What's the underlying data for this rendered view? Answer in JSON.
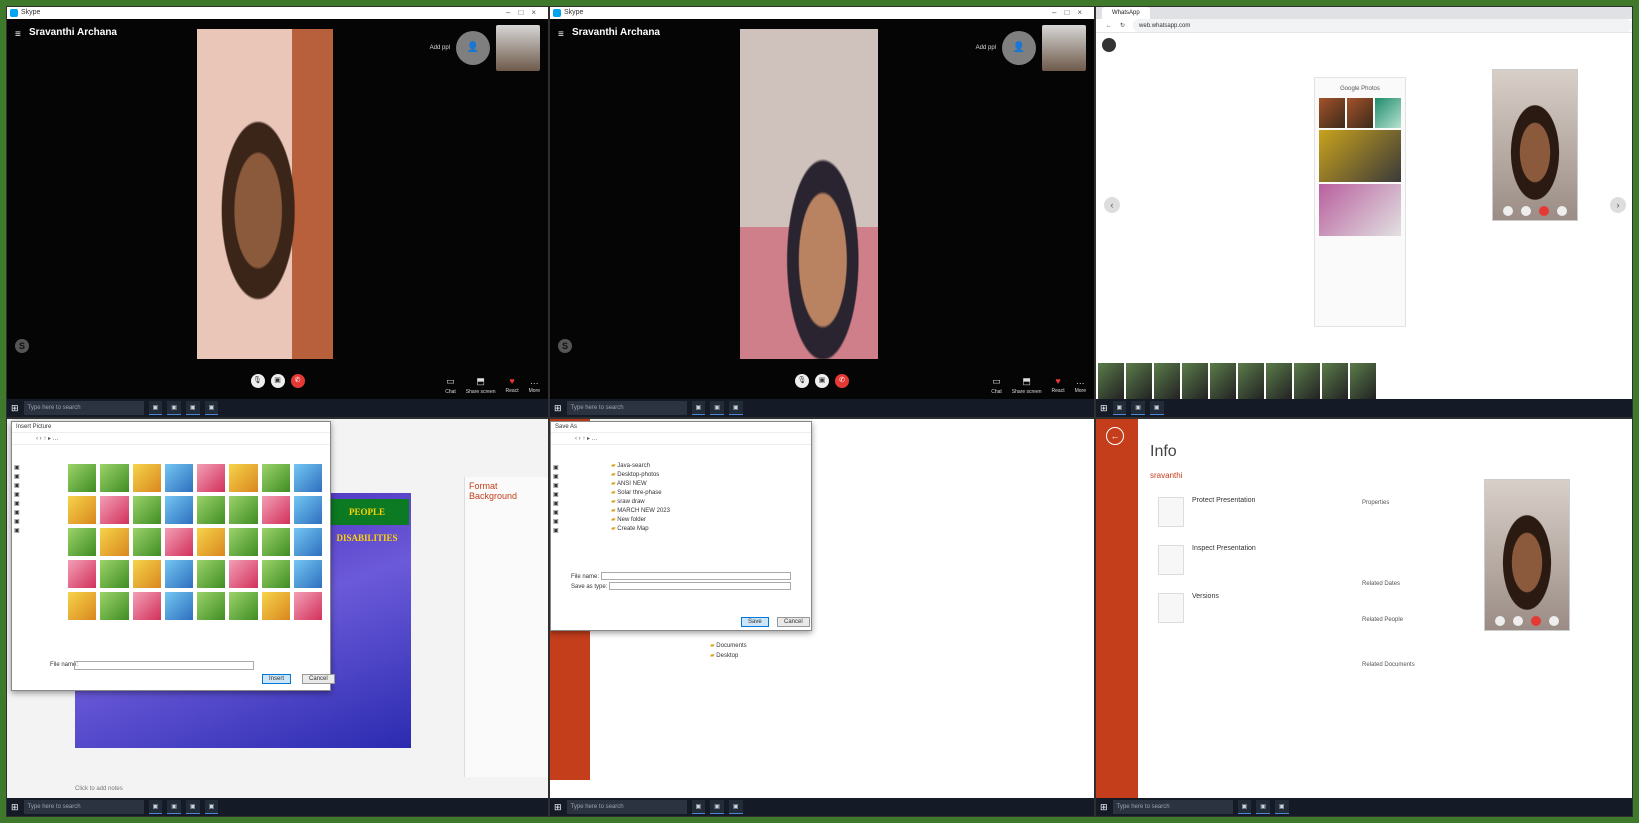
{
  "skype_window_title": "Skype",
  "skype_left": {
    "contact_name": "Sravanthi Archana",
    "add_people": "Add ppl"
  },
  "skype_mid": {
    "contact_name": "Sravanthi Archana",
    "add_people": "Add ppl"
  },
  "skype_tools": {
    "chat": "Chat",
    "share": "Share screen",
    "react": "React",
    "more": "More"
  },
  "chrome": {
    "tab": "WhatsApp",
    "url": "web.whatsapp.com",
    "phone_app_title": "Google Photos"
  },
  "ppt": {
    "insert_dialog_title": "Insert Picture",
    "slide_title": "PEOPLE DISABILITIES",
    "format_pane_title": "Format Background",
    "file_name_label": "File name:",
    "insert_button": "Insert",
    "cancel_button": "Cancel",
    "click_to_add_notes": "Click to add notes"
  },
  "save_dialog": {
    "title": "Save As",
    "file_name_label": "File name:",
    "save_type_label": "Save as type:",
    "save_button": "Save",
    "cancel_button": "Cancel",
    "folders": [
      "Java-search",
      "Desktop-photos",
      "ANSI NEW",
      "Solar thre-phase",
      "sraw draw",
      "MARCH NEW 2023",
      "New folder",
      "Create Map"
    ],
    "places": [
      "Documents",
      "Desktop"
    ]
  },
  "backstage": {
    "heading": "Info",
    "user": "sravanthi",
    "sections": [
      {
        "title": "Protect Presentation"
      },
      {
        "title": "Inspect Presentation"
      },
      {
        "title": "Versions"
      }
    ],
    "properties_title": "Properties",
    "related_dates": "Related Dates",
    "related_people": "Related People",
    "related_docs": "Related Documents"
  },
  "taskbar_search": "Type here to search",
  "colors": {
    "ppt_orange": "#c43e1c",
    "skype_blue": "#00a4ef",
    "end_call_red": "#e53935"
  }
}
